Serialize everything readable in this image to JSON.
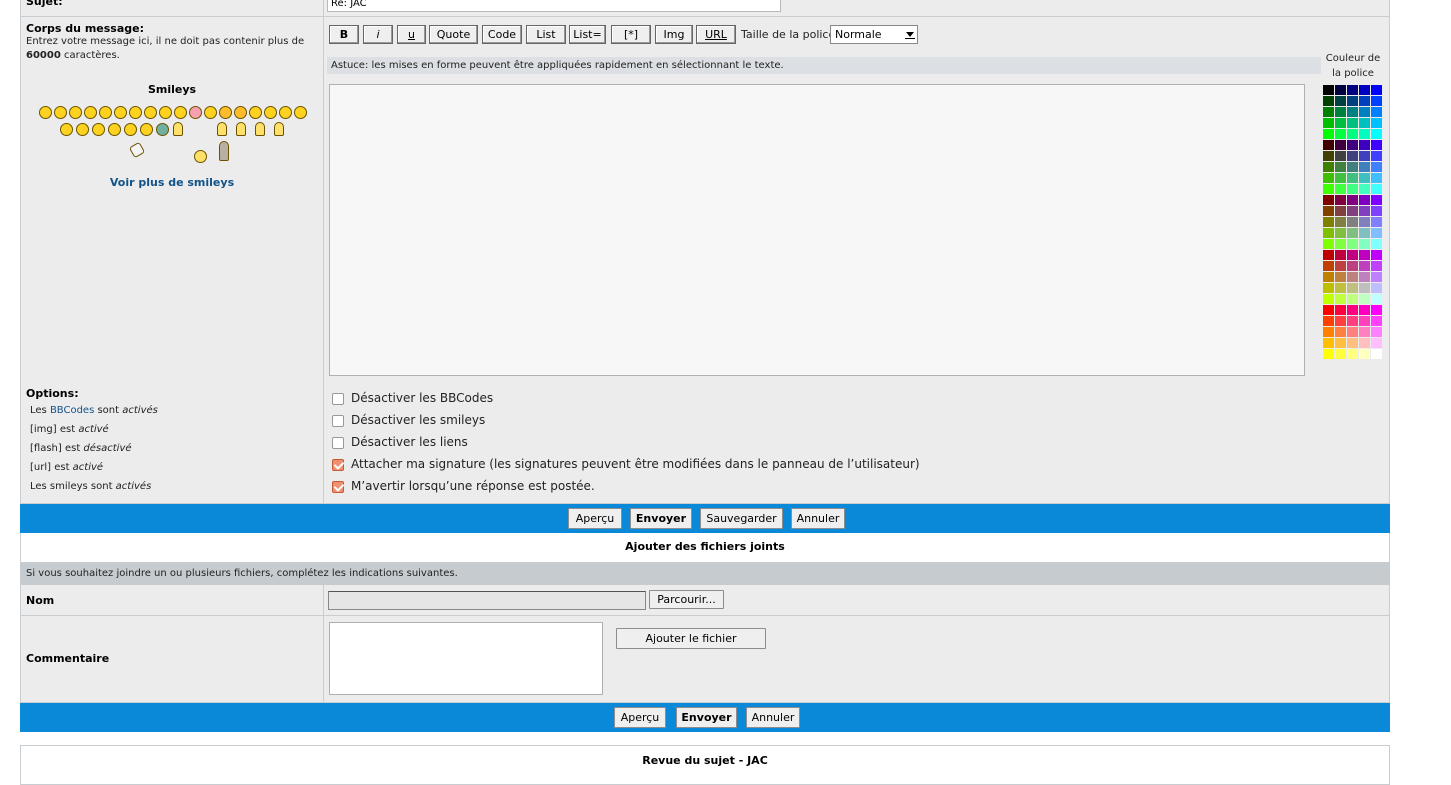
{
  "subject": {
    "label": "Sujet:",
    "value": "Re: JAC"
  },
  "body": {
    "label": "Corps du message:",
    "desc_prefix": "Entrez votre message ici, il ne doit pas contenir plus de ",
    "desc_limit": "60000",
    "desc_suffix": " caractères.",
    "smileys_title": "Smileys",
    "more_smileys": "Voir plus de smileys",
    "hint": "Astuce: les mises en forme peuvent être appliquées rapidement en sélectionnant le texte.",
    "color_title": "Couleur de la police",
    "font_size_label": "Taille de la police:",
    "font_size_value": "Normale",
    "message_value": ""
  },
  "toolbar": {
    "bold": "B",
    "italic": "i",
    "underline": "u",
    "quote": "Quote",
    "code": "Code",
    "list": "List",
    "list_eq": "List=",
    "list_item": "[*]",
    "img": "Img",
    "url": "URL"
  },
  "options": {
    "label": "Options:",
    "state_bbcode_prefix": "Les ",
    "state_bbcode_link": "BBCodes",
    "state_bbcode_mid": " sont ",
    "state_bbcode_value": "activés",
    "state_img_prefix": "[img] est ",
    "state_img_value": "activé",
    "state_flash_prefix": "[flash] est ",
    "state_flash_value": "désactivé",
    "state_url_prefix": "[url] est ",
    "state_url_value": "activé",
    "state_smileys_prefix": "Les smileys sont ",
    "state_smileys_value": "activés",
    "cb_disable_bbcode": "Désactiver les BBCodes",
    "cb_disable_smileys": "Désactiver les smileys",
    "cb_disable_links": "Désactiver les liens",
    "cb_signature": "Attacher ma signature (les signatures peuvent être modifiées dans le panneau de l’utilisateur)",
    "cb_notify": "M’avertir lorsqu’une réponse est postée."
  },
  "buttons": {
    "preview": "Aperçu",
    "submit": "Envoyer",
    "save": "Sauvegarder",
    "cancel": "Annuler"
  },
  "attachments": {
    "title": "Ajouter des fichiers joints",
    "info": "Si vous souhaitez joindre un ou plusieurs fichiers, complétez les indications suivantes.",
    "name_label": "Nom",
    "browse": "Parcourir...",
    "comment_label": "Commentaire",
    "add_file": "Ajouter le fichier"
  },
  "review": {
    "title": "Revue du sujet - JAC"
  },
  "colors": {
    "bar_blue": "#0a89d8",
    "link_blue": "#105289",
    "row_bg": "#ececec"
  }
}
